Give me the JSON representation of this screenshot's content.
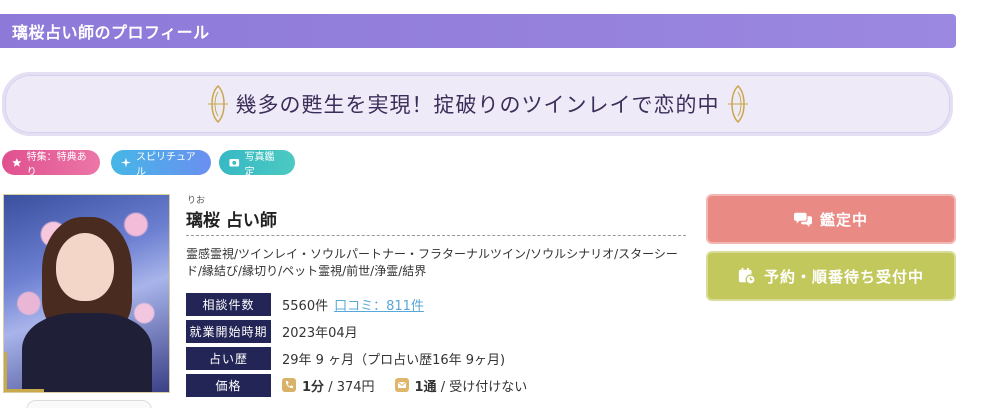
{
  "header": {
    "title": "璃桜占い師のプロフィール"
  },
  "catchphrase": "幾多の甦生を実現！掟破りのツインレイで恋的中",
  "tags": [
    {
      "label": "特集：特典あり",
      "icon": "star-icon",
      "color": "#e0508f"
    },
    {
      "label": "スピリチュアル",
      "icon": "sparkle-icon",
      "color": "#5aa2ec"
    },
    {
      "label": "写真鑑定",
      "icon": "photo-icon",
      "color": "#3dbfc3"
    }
  ],
  "profile": {
    "ruby": "りお",
    "name": "璃桜 占い師",
    "specialties": "霊感霊視/ツインレイ・ソウルパートナー・フラターナルツイン/ソウルシナリオ/スターシード/縁結び/縁切り/ペット霊視/前世/浄霊/結界"
  },
  "info": {
    "consult_count": {
      "label": "相談件数",
      "value": "5560件",
      "review": "口コミ：811件"
    },
    "start_date": {
      "label": "就業開始時期",
      "value": "2023年04月"
    },
    "career": {
      "label": "占い歴",
      "value": "29年 9 ヶ月（プロ占い歴16年 9ヶ月)"
    },
    "price": {
      "label": "価格",
      "phone_unit": "1分",
      "phone_price": "/ 374円",
      "mail_unit": "1通",
      "mail_price": "/ 受け付けない"
    }
  },
  "buttons": {
    "consult": "鑑定中",
    "reserve": "予約・順番待ち受付中"
  },
  "colors": {
    "header": "#8d79d8",
    "label_bg": "#232556",
    "consult_btn": "#e98a85",
    "reserve_btn": "#c3c85c",
    "link": "#5aa8d8"
  }
}
